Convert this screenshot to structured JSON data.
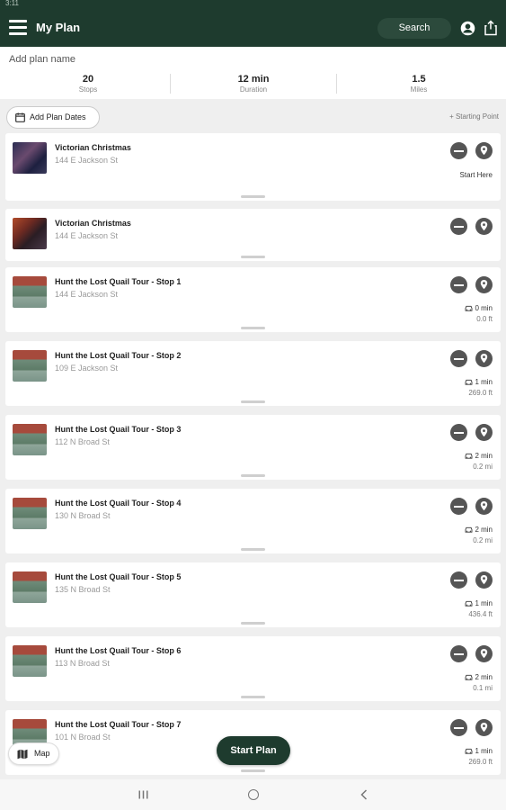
{
  "status_bar": {
    "time": "3:11"
  },
  "app_bar": {
    "title": "My Plan",
    "search_label": "Search"
  },
  "plan": {
    "name_placeholder": "Add plan name",
    "stats": [
      {
        "value": "20",
        "label": "Stops"
      },
      {
        "value": "12 min",
        "label": "Duration"
      },
      {
        "value": "1.5",
        "label": "Miles"
      }
    ]
  },
  "actions": {
    "add_dates_label": "Add Plan Dates",
    "starting_point_label": "+ Starting Point"
  },
  "stops": [
    {
      "title": "Victorian Christmas",
      "address": "144 E Jackson St",
      "image": "thumb-xmas",
      "start_here": "Start Here",
      "drive_time": "",
      "distance": ""
    },
    {
      "title": "Victorian Christmas",
      "address": "144 E Jackson St",
      "image": "thumb-xmas2",
      "start_here": "",
      "drive_time": "",
      "distance": ""
    },
    {
      "title": "Hunt the Lost Quail Tour - Stop 1",
      "address": "144 E Jackson St",
      "image": "thumb-quail",
      "start_here": "",
      "drive_time": "0 min",
      "distance": "0.0 ft"
    },
    {
      "title": "Hunt the Lost Quail Tour - Stop 2",
      "address": "109 E Jackson St",
      "image": "thumb-quail",
      "start_here": "",
      "drive_time": "1 min",
      "distance": "269.0 ft"
    },
    {
      "title": "Hunt the Lost Quail Tour - Stop 3",
      "address": "112 N Broad St",
      "image": "thumb-quail",
      "start_here": "",
      "drive_time": "2 min",
      "distance": "0.2 mi"
    },
    {
      "title": "Hunt the Lost Quail Tour - Stop 4",
      "address": "130 N Broad St",
      "image": "thumb-quail",
      "start_here": "",
      "drive_time": "2 min",
      "distance": "0.2 mi"
    },
    {
      "title": "Hunt the Lost Quail Tour - Stop 5",
      "address": "135 N Broad St",
      "image": "thumb-quail",
      "start_here": "",
      "drive_time": "1 min",
      "distance": "436.4 ft"
    },
    {
      "title": "Hunt the Lost Quail Tour - Stop 6",
      "address": "113 N Broad St",
      "image": "thumb-quail",
      "start_here": "",
      "drive_time": "2 min",
      "distance": "0.1 mi"
    },
    {
      "title": "Hunt the Lost Quail Tour - Stop 7",
      "address": "101 N Broad St",
      "image": "thumb-quail",
      "start_here": "",
      "drive_time": "1 min",
      "distance": "269.0 ft"
    }
  ],
  "bottom": {
    "map_label": "Map",
    "start_plan_label": "Start Plan"
  },
  "colors": {
    "brand": "#1e3b2e",
    "background": "#efefef"
  },
  "icons": [
    "menu-icon",
    "account-icon",
    "share-icon",
    "calendar-icon",
    "remove-icon",
    "map-pin-icon",
    "car-icon",
    "map-icon"
  ]
}
